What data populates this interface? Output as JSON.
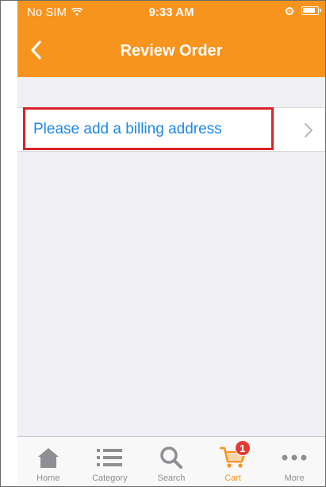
{
  "status": {
    "carrier": "No SIM",
    "time": "9:33 AM"
  },
  "navbar": {
    "title": "Review Order"
  },
  "billing": {
    "label": "Please add a billing address"
  },
  "tabbar": {
    "tabs": [
      {
        "label": "Home",
        "icon": "home-icon"
      },
      {
        "label": "Category",
        "icon": "list-icon"
      },
      {
        "label": "Search",
        "icon": "search-icon"
      },
      {
        "label": "Cart",
        "icon": "cart-icon",
        "badge": "1",
        "active": true
      },
      {
        "label": "More",
        "icon": "more-icon"
      }
    ]
  },
  "colors": {
    "brand": "#f7941d",
    "link": "#1e88e5",
    "highlight": "#d9222a",
    "badge": "#e53935"
  }
}
